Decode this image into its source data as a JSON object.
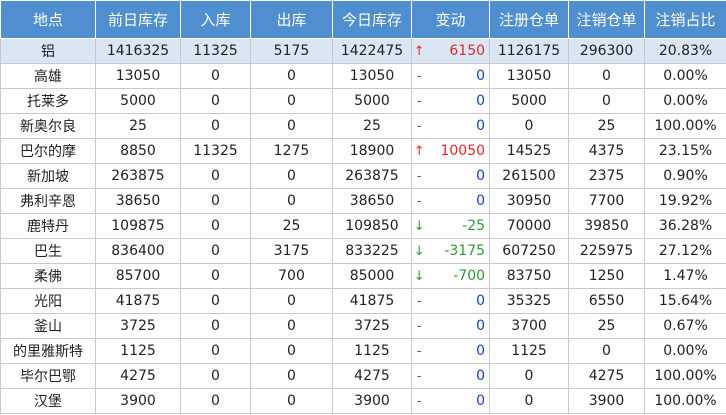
{
  "headers": [
    "地点",
    "前日库存",
    "入库",
    "出库",
    "今日库存",
    "变动",
    "注册仓单",
    "注销仓单",
    "注销占比"
  ],
  "colors": {
    "header_bg": "#4f8fcf",
    "first_row_bg": "#dae6f3",
    "up": "#e02a2a",
    "down": "#2e9b3a",
    "flat": "#2f5fbf"
  },
  "rows": [
    {
      "location": "铝",
      "prev": "1416325",
      "in": "11325",
      "out": "5175",
      "today": "1422475",
      "arrow": "↑",
      "dir": "up",
      "change": "6150",
      "registered": "1126175",
      "cancelled": "296300",
      "ratio": "20.83%"
    },
    {
      "location": "高雄",
      "prev": "13050",
      "in": "0",
      "out": "0",
      "today": "13050",
      "arrow": "-",
      "dir": "flat",
      "change": "0",
      "registered": "13050",
      "cancelled": "0",
      "ratio": "0.00%"
    },
    {
      "location": "托莱多",
      "prev": "5000",
      "in": "0",
      "out": "0",
      "today": "5000",
      "arrow": "-",
      "dir": "flat",
      "change": "0",
      "registered": "5000",
      "cancelled": "0",
      "ratio": "0.00%"
    },
    {
      "location": "新奥尔良",
      "prev": "25",
      "in": "0",
      "out": "0",
      "today": "25",
      "arrow": "-",
      "dir": "flat",
      "change": "0",
      "registered": "0",
      "cancelled": "25",
      "ratio": "100.00%"
    },
    {
      "location": "巴尔的摩",
      "prev": "8850",
      "in": "11325",
      "out": "1275",
      "today": "18900",
      "arrow": "↑",
      "dir": "up",
      "change": "10050",
      "registered": "14525",
      "cancelled": "4375",
      "ratio": "23.15%"
    },
    {
      "location": "新加坡",
      "prev": "263875",
      "in": "0",
      "out": "0",
      "today": "263875",
      "arrow": "-",
      "dir": "flat",
      "change": "0",
      "registered": "261500",
      "cancelled": "2375",
      "ratio": "0.90%"
    },
    {
      "location": "弗利辛恩",
      "prev": "38650",
      "in": "0",
      "out": "0",
      "today": "38650",
      "arrow": "-",
      "dir": "flat",
      "change": "0",
      "registered": "30950",
      "cancelled": "7700",
      "ratio": "19.92%"
    },
    {
      "location": "鹿特丹",
      "prev": "109875",
      "in": "0",
      "out": "25",
      "today": "109850",
      "arrow": "↓",
      "dir": "down",
      "change": "-25",
      "registered": "70000",
      "cancelled": "39850",
      "ratio": "36.28%"
    },
    {
      "location": "巴生",
      "prev": "836400",
      "in": "0",
      "out": "3175",
      "today": "833225",
      "arrow": "↓",
      "dir": "down",
      "change": "-3175",
      "registered": "607250",
      "cancelled": "225975",
      "ratio": "27.12%"
    },
    {
      "location": "柔佛",
      "prev": "85700",
      "in": "0",
      "out": "700",
      "today": "85000",
      "arrow": "↓",
      "dir": "down",
      "change": "-700",
      "registered": "83750",
      "cancelled": "1250",
      "ratio": "1.47%"
    },
    {
      "location": "光阳",
      "prev": "41875",
      "in": "0",
      "out": "0",
      "today": "41875",
      "arrow": "-",
      "dir": "flat",
      "change": "0",
      "registered": "35325",
      "cancelled": "6550",
      "ratio": "15.64%"
    },
    {
      "location": "釜山",
      "prev": "3725",
      "in": "0",
      "out": "0",
      "today": "3725",
      "arrow": "-",
      "dir": "flat",
      "change": "0",
      "registered": "3700",
      "cancelled": "25",
      "ratio": "0.67%"
    },
    {
      "location": "的里雅斯特",
      "prev": "1125",
      "in": "0",
      "out": "0",
      "today": "1125",
      "arrow": "-",
      "dir": "flat",
      "change": "0",
      "registered": "1125",
      "cancelled": "0",
      "ratio": "0.00%"
    },
    {
      "location": "毕尔巴鄂",
      "prev": "4275",
      "in": "0",
      "out": "0",
      "today": "4275",
      "arrow": "-",
      "dir": "flat",
      "change": "0",
      "registered": "0",
      "cancelled": "4275",
      "ratio": "100.00%"
    },
    {
      "location": "汉堡",
      "prev": "3900",
      "in": "0",
      "out": "0",
      "today": "3900",
      "arrow": "-",
      "dir": "flat",
      "change": "0",
      "registered": "0",
      "cancelled": "3900",
      "ratio": "100.00%"
    }
  ]
}
